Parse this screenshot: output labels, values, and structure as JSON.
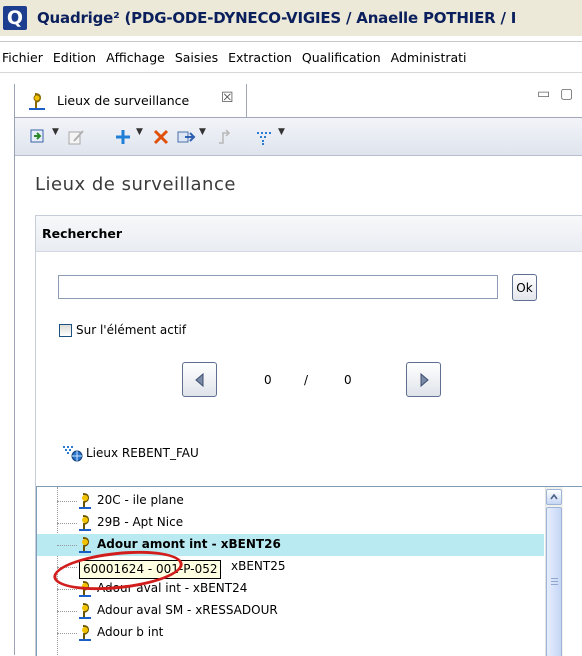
{
  "app": {
    "title": "Quadrige² (PDG-ODE-DYNECO-VIGIES / Anaelle POTHIER / I",
    "logo_letter": "Q"
  },
  "menu": [
    "Fichier",
    "Edition",
    "Affichage",
    "Saisies",
    "Extraction",
    "Qualification",
    "Administrati"
  ],
  "tab": {
    "label": "Lieux de surveillance",
    "close_glyph": "☒"
  },
  "view": {
    "title": "Lieux de surveillance"
  },
  "search": {
    "section_title": "Rechercher",
    "input_value": "",
    "ok_label": "Ok",
    "checkbox_label": "Sur l'élément actif",
    "checkbox_checked": false
  },
  "pager": {
    "current": "0",
    "separator": "/",
    "total": "0"
  },
  "tree": {
    "root_label": "Lieux REBENT_FAU",
    "items": [
      {
        "label": "20C - ile plane",
        "selected": false
      },
      {
        "label": "29B - Apt Nice",
        "selected": false
      },
      {
        "label": "Adour amont int - xBENT26",
        "selected": true
      },
      {
        "label": "xBENT25",
        "selected": false
      },
      {
        "label": "Adour aval int - xBENT24",
        "selected": false
      },
      {
        "label": "Adour aval SM - xRESSADOUR",
        "selected": false
      },
      {
        "label": "Adour b int",
        "selected": false
      }
    ]
  },
  "tooltip": {
    "text": "60001624 - 001-P-052"
  },
  "colors": {
    "selection": "#b9eaf2",
    "annotation_ring": "#d21d1d",
    "title_text": "#0a1f5c"
  }
}
